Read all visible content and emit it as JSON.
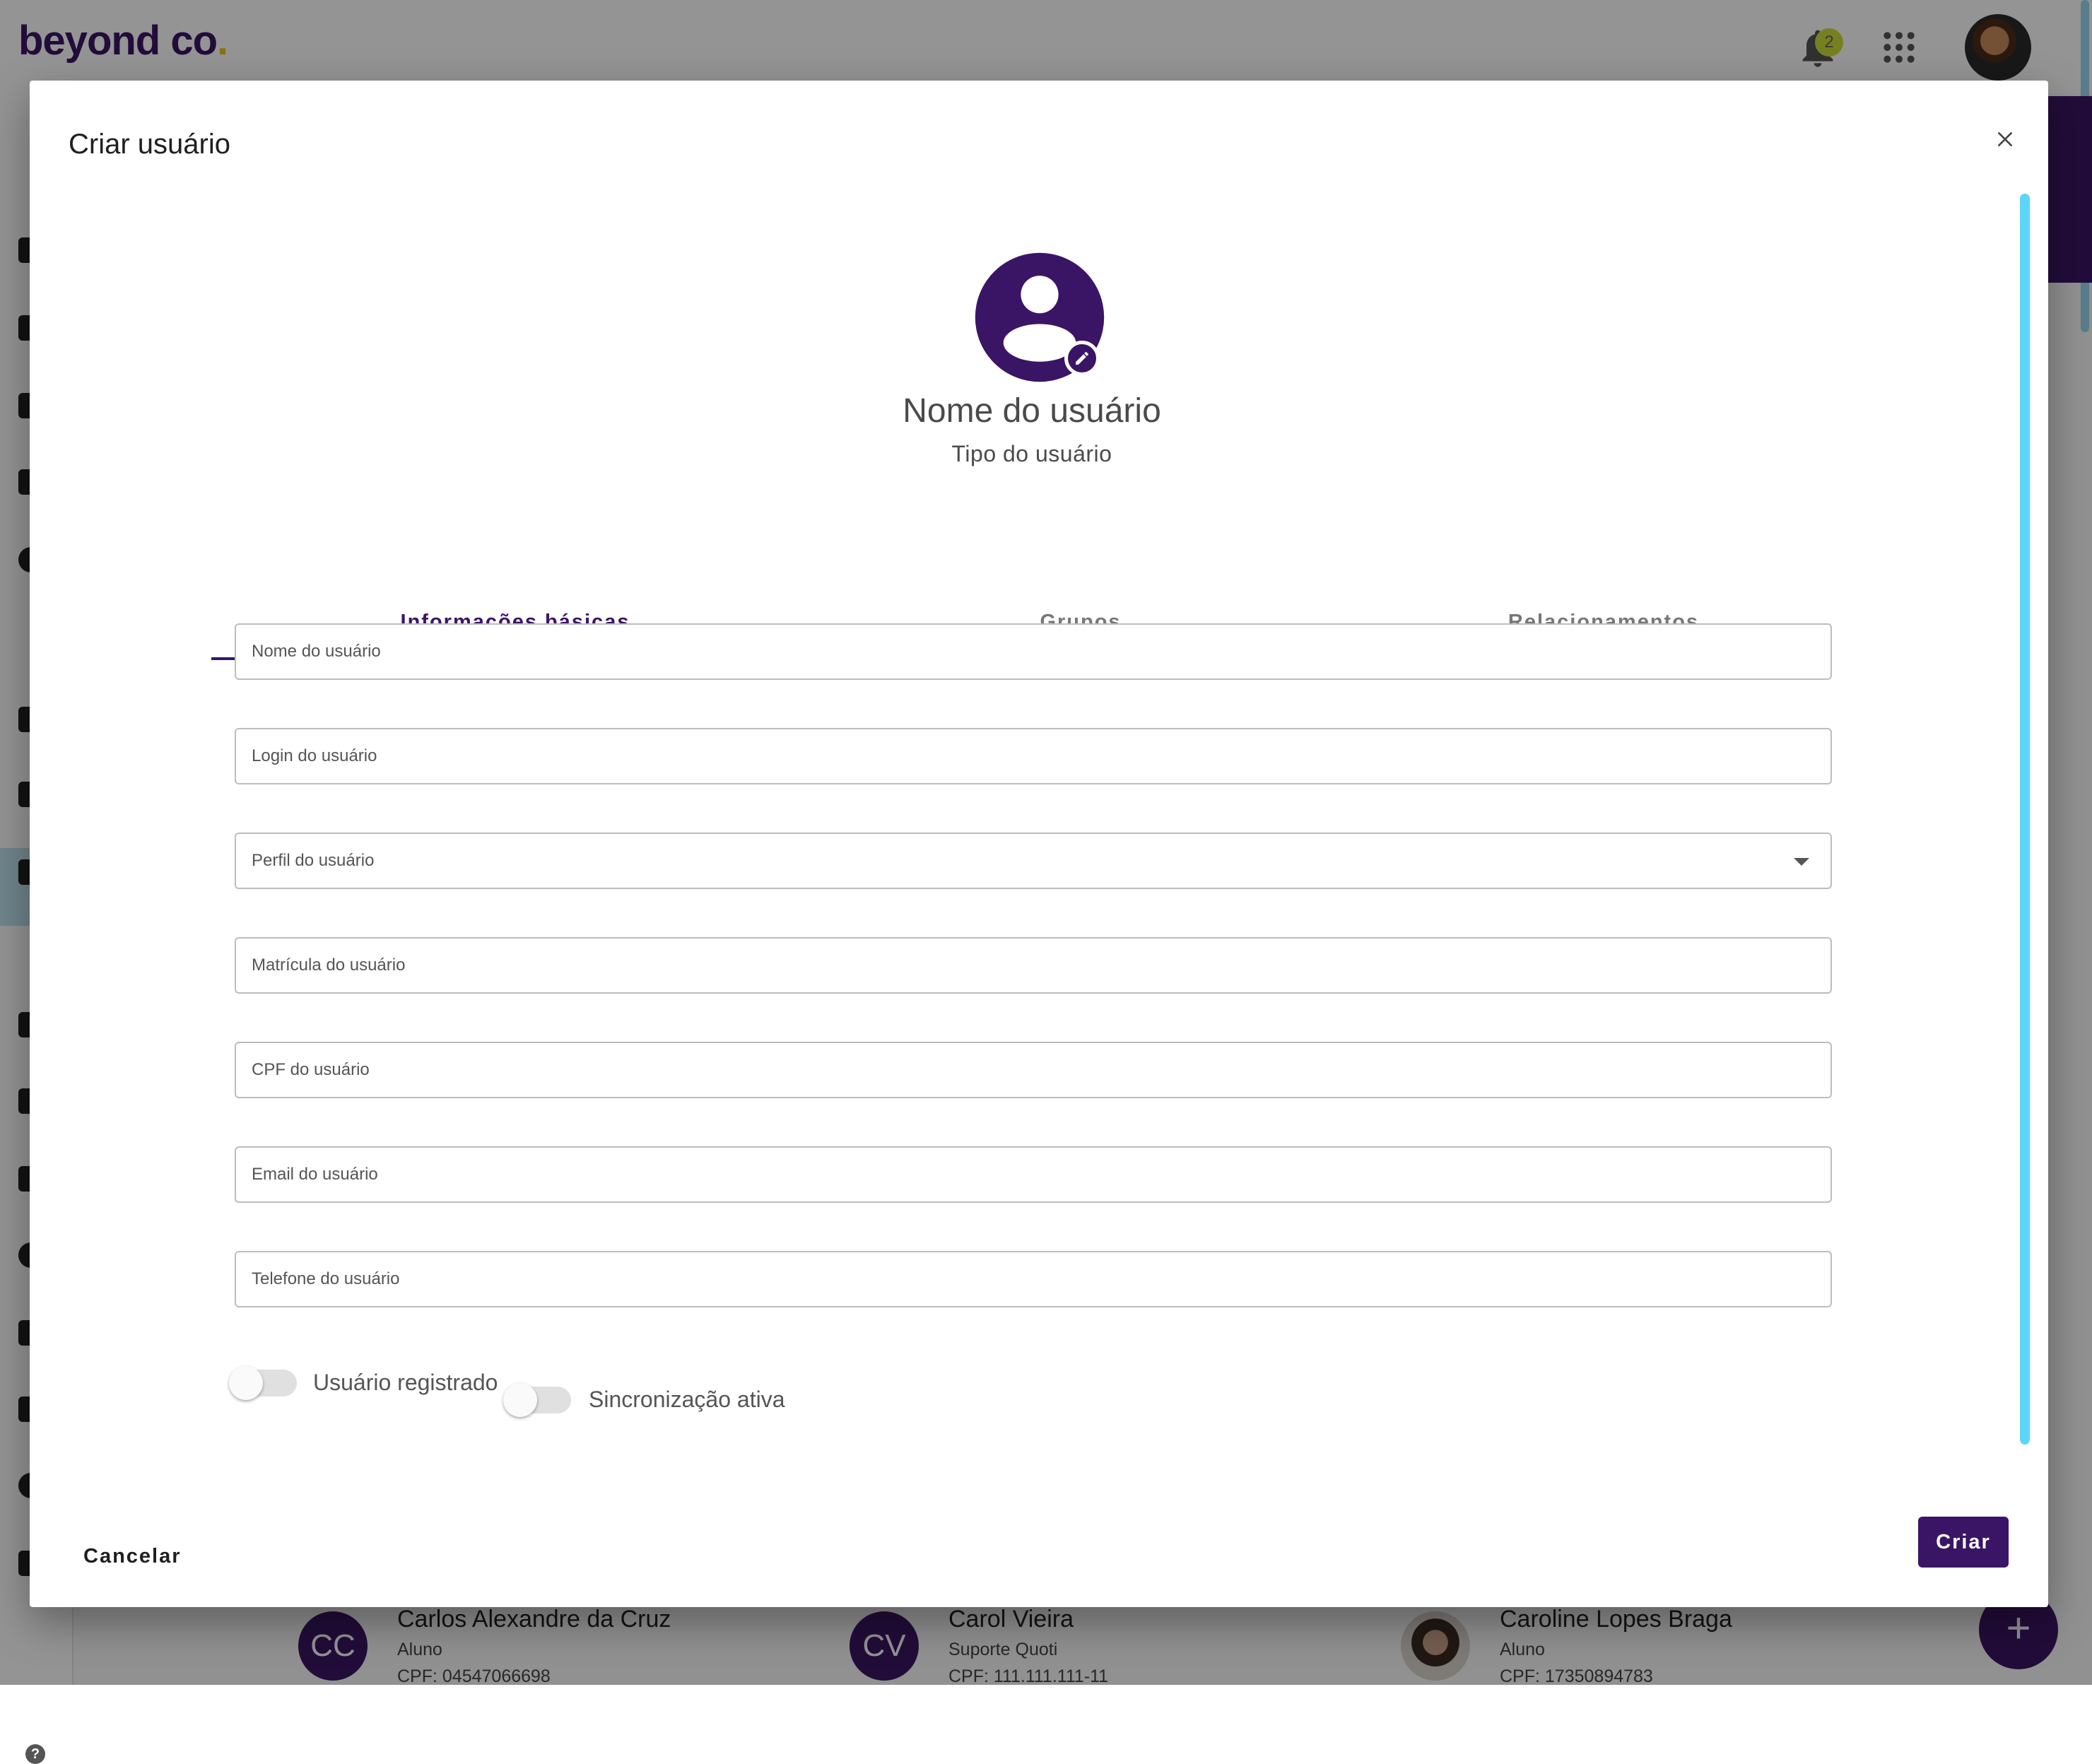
{
  "app": {
    "logo_text": "beyond co",
    "logo_dot": ".",
    "notifications_count": "2",
    "colors": {
      "brand": "#3b1565",
      "accent_yellow": "#f2c21a",
      "badge": "#cddc39",
      "scroll": "#5cd6f6"
    }
  },
  "background_cards": [
    {
      "initials": "CC",
      "name": "Carlos Alexandre da Cruz",
      "role": "Aluno",
      "cpf": "CPF: 04547066698"
    },
    {
      "initials": "CV",
      "name": "Carol Vieira",
      "role": "Suporte Quoti",
      "cpf": "CPF: 111.111.111-11"
    },
    {
      "initials": "",
      "name": "Caroline Lopes Braga",
      "role": "Aluno",
      "cpf": "CPF: 17350894783"
    }
  ],
  "fab_label": "+",
  "dialog": {
    "title": "Criar usuário",
    "close_icon": "close-icon",
    "profile": {
      "name": "Nome do usuário",
      "type": "Tipo do usuário"
    },
    "tabs": [
      {
        "label": "Informações básicas",
        "active": true
      },
      {
        "label": "Grupos",
        "active": false
      },
      {
        "label": "Relacionamentos",
        "active": false
      }
    ],
    "fields": {
      "name": {
        "placeholder": "Nome do usuário",
        "value": ""
      },
      "login": {
        "placeholder": "Login do usuário",
        "value": ""
      },
      "profile": {
        "label": "Perfil do usuário",
        "value": ""
      },
      "registration": {
        "placeholder": "Matrícula do usuário",
        "value": ""
      },
      "cpf": {
        "placeholder": "CPF do usuário",
        "value": ""
      },
      "email": {
        "placeholder": "Email do usuário",
        "value": ""
      },
      "phone": {
        "placeholder": "Telefone do usuário",
        "value": ""
      }
    },
    "toggles": [
      {
        "label": "Usuário registrado",
        "on": false
      },
      {
        "label": "Sincronização ativa",
        "on": false
      }
    ],
    "actions": {
      "cancel": "Cancelar",
      "create": "Criar"
    }
  }
}
